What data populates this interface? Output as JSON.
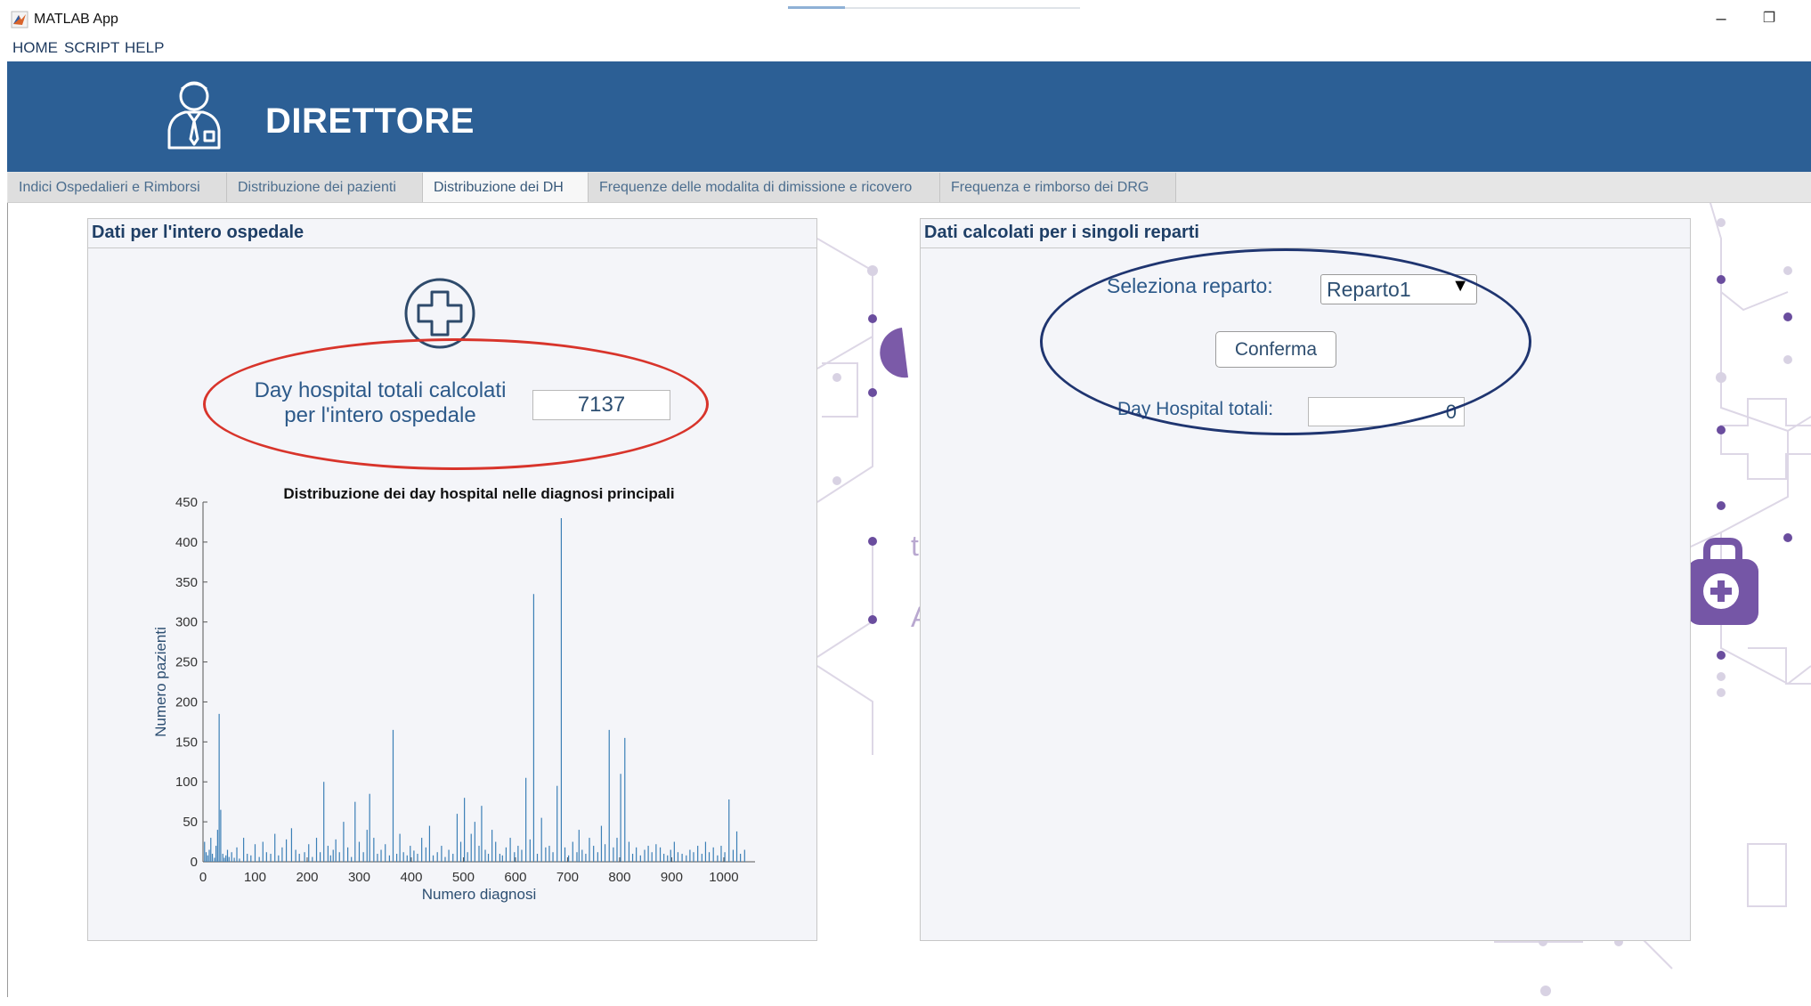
{
  "window": {
    "title": "MATLAB App",
    "minimize": "–",
    "restore": "❐",
    "progress": 0.2
  },
  "menu": [
    "HOME",
    "SCRIPT",
    "HELP"
  ],
  "header": {
    "title": "DIRETTORE",
    "icon": "manager-person-icon",
    "background": "#2c5f95"
  },
  "tabs": [
    {
      "label": "Indici Ospedalieri e Rimborsi",
      "active": false
    },
    {
      "label": "Distribuzione dei pazienti",
      "active": false
    },
    {
      "label": "Distribuzione dei DH",
      "active": true
    },
    {
      "label": "Frequenze delle modalita di dimissione e ricovero",
      "active": false
    },
    {
      "label": "Frequenza e rimborso dei DRG",
      "active": false
    }
  ],
  "left_panel": {
    "title": "Dati per l'intero ospedale",
    "icon": "hospital-cross-icon",
    "total_label_line1": "Day hospital totali calcolati",
    "total_label_line2": "per l'intero ospedale",
    "total_value": "7137",
    "highlight_color": "#d8342b"
  },
  "right_panel": {
    "title": "Dati calcolati per i singoli reparti",
    "select_label": "Seleziona reparto:",
    "select_value": "Reparto1",
    "confirm_button": "Conferma",
    "totals_label": "Day Hospital totali:",
    "totals_value": "0",
    "highlight_color": "#1f3570"
  },
  "chart_data": {
    "type": "bar",
    "title": "Distribuzione dei day hospital nelle diagnosi principali",
    "xlabel": "Numero diagnosi",
    "ylabel": "Numero pazienti",
    "xlim": [
      0,
      1060
    ],
    "ylim": [
      0,
      450
    ],
    "xticks": [
      0,
      100,
      200,
      300,
      400,
      500,
      600,
      700,
      800,
      900,
      1000
    ],
    "yticks": [
      0,
      50,
      100,
      150,
      200,
      250,
      300,
      350,
      400,
      450
    ],
    "color": "#3b7fb6",
    "x": [
      3,
      6,
      9,
      12,
      15,
      18,
      22,
      25,
      28,
      31,
      34,
      38,
      41,
      44,
      47,
      50,
      55,
      60,
      65,
      70,
      78,
      85,
      92,
      100,
      108,
      115,
      122,
      130,
      138,
      145,
      152,
      160,
      170,
      178,
      185,
      195,
      203,
      210,
      218,
      225,
      232,
      240,
      245,
      250,
      255,
      262,
      270,
      278,
      285,
      292,
      300,
      308,
      315,
      320,
      328,
      335,
      342,
      350,
      358,
      365,
      372,
      378,
      385,
      392,
      398,
      405,
      412,
      420,
      428,
      435,
      442,
      450,
      458,
      465,
      472,
      480,
      488,
      495,
      502,
      508,
      515,
      522,
      530,
      535,
      542,
      548,
      555,
      562,
      570,
      575,
      582,
      590,
      598,
      605,
      612,
      620,
      628,
      635,
      642,
      650,
      658,
      665,
      672,
      680,
      688,
      695,
      702,
      710,
      718,
      722,
      728,
      735,
      742,
      750,
      758,
      765,
      772,
      780,
      788,
      795,
      802,
      810,
      818,
      825,
      832,
      840,
      848,
      855,
      862,
      870,
      878,
      885,
      892,
      898,
      905,
      912,
      920,
      928,
      935,
      942,
      950,
      958,
      965,
      972,
      980,
      988,
      995,
      1002,
      1010,
      1018,
      1025,
      1032,
      1040
    ],
    "values": [
      25,
      12,
      8,
      15,
      30,
      10,
      5,
      20,
      40,
      185,
      65,
      10,
      5,
      8,
      15,
      6,
      12,
      5,
      18,
      4,
      30,
      10,
      8,
      22,
      6,
      25,
      12,
      10,
      35,
      8,
      18,
      28,
      42,
      15,
      10,
      12,
      22,
      6,
      30,
      12,
      100,
      20,
      8,
      15,
      28,
      12,
      50,
      18,
      6,
      75,
      25,
      12,
      40,
      85,
      30,
      10,
      15,
      22,
      8,
      165,
      10,
      35,
      12,
      8,
      20,
      14,
      10,
      30,
      18,
      45,
      8,
      12,
      20,
      6,
      15,
      10,
      60,
      25,
      80,
      12,
      35,
      50,
      20,
      70,
      15,
      10,
      40,
      25,
      10,
      8,
      18,
      30,
      12,
      20,
      15,
      105,
      28,
      335,
      10,
      55,
      18,
      20,
      12,
      95,
      430,
      18,
      8,
      25,
      12,
      40,
      15,
      10,
      30,
      20,
      12,
      45,
      22,
      165,
      18,
      30,
      110,
      155,
      25,
      10,
      18,
      8,
      15,
      20,
      12,
      22,
      18,
      10,
      8,
      15,
      25,
      12,
      10,
      8,
      15,
      12,
      20,
      10,
      25,
      12,
      18,
      8,
      20,
      12,
      78,
      15,
      38,
      10,
      15
    ]
  }
}
